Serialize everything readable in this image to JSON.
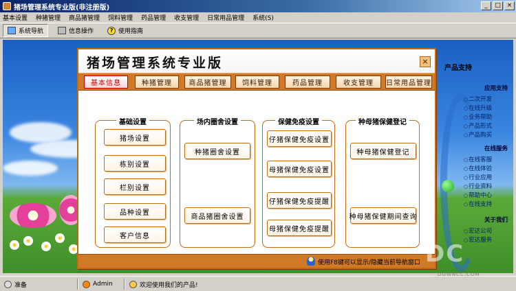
{
  "window": {
    "title": "猪场管理系统专业版(非注册版)",
    "buttons": [
      "_",
      "□",
      "×"
    ]
  },
  "menu": [
    "基本设置",
    "种猪管理",
    "商品猪管理",
    "饲料管理",
    "药品管理",
    "收支管理",
    "日常用品管理",
    "系统(S)"
  ],
  "toolbar": {
    "nav": "系统导航",
    "info": "信息操作",
    "help": "使用指南",
    "help_glyph": "?"
  },
  "right_panel": {
    "heading": "产品支持",
    "sections": [
      {
        "title": "应用支持",
        "items": [
          "二次开发",
          "在线升级",
          "业务帮助",
          "产品形式",
          "产品购买"
        ]
      },
      {
        "title": "在线服务",
        "items": [
          "在线客服",
          "在线体验",
          "行业应用",
          "行业资料",
          "帮助中心",
          "在线支持"
        ]
      },
      {
        "title": "关于我们",
        "items": [
          "宏达公司",
          "宏达服务"
        ]
      }
    ]
  },
  "dialog": {
    "title": "猪场管理系统专业版",
    "close": "×",
    "tabs": [
      "基本信息",
      "种猪管理",
      "商品猪管理",
      "饲料管理",
      "药品管理",
      "收支管理",
      "日常用品管理"
    ],
    "active_tab": 0,
    "groups": [
      {
        "title": "基础设置",
        "buttons": [
          "猪场设置",
          "栋别设置",
          "栏别设置",
          "品种设置",
          "客户信息"
        ]
      },
      {
        "title": "场内圈舍设置",
        "buttons": [
          "种猪圈舍设置",
          "商品猪圈舍设置"
        ]
      },
      {
        "title": "保健免疫设置",
        "buttons": [
          "仔猪保健免疫设置",
          "母猪保健免疫设置",
          "仔猪保健免疫提醒",
          "母猪保健免疫提醒"
        ]
      },
      {
        "title": "种母猪保健登记",
        "buttons": [
          "种母猪保健登记",
          "种母猪保健期间查询"
        ]
      }
    ],
    "footer": "使用F8键可以显示/隐藏当前导航窗口"
  },
  "status": {
    "state": "准备",
    "user": "Admin",
    "message": "欢迎使用我们的产品!"
  },
  "watermark": {
    "logo": "DC",
    "site": "DOWNCC.COM"
  },
  "colors": {
    "accent": "#d07a28",
    "border": "#c46a10",
    "active_tab_text": "#c00000"
  }
}
